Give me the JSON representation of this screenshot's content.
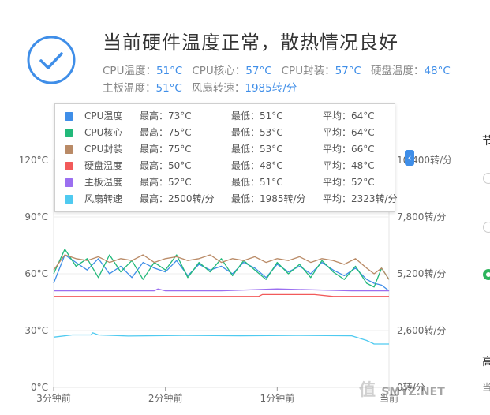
{
  "header": {
    "title": "当前硬件温度正常，散热情况良好",
    "metrics_row1": [
      {
        "label": "CPU温度：",
        "value": "51°C"
      },
      {
        "label": "CPU核心：",
        "value": "57°C"
      },
      {
        "label": "CPU封装：",
        "value": "57°C"
      },
      {
        "label": "硬盘温度：",
        "value": "48°C"
      }
    ],
    "metrics_row2": [
      {
        "label": "主板温度：",
        "value": "51°C"
      },
      {
        "label": "风扇转速：",
        "value": "1985转/分"
      }
    ]
  },
  "tooltip": {
    "rows": [
      {
        "name": "CPU温度",
        "color": "#3f8ee8",
        "max": "最高：73°C",
        "min": "最低：51°C",
        "avg": "平均：64°C"
      },
      {
        "name": "CPU核心",
        "color": "#22b97a",
        "max": "最高：75°C",
        "min": "最低：53°C",
        "avg": "平均：64°C"
      },
      {
        "name": "CPU封装",
        "color": "#b98a66",
        "max": "最高：75°C",
        "min": "最低：53°C",
        "avg": "平均：66°C"
      },
      {
        "name": "硬盘温度",
        "color": "#f25a5a",
        "max": "最高：50°C",
        "min": "最低：48°C",
        "avg": "平均：48°C"
      },
      {
        "name": "主板温度",
        "color": "#9b6ff0",
        "max": "最高：52°C",
        "min": "最低：51°C",
        "avg": "平均：52°C"
      },
      {
        "name": "风扇转速",
        "color": "#4fcaf0",
        "max": "最高：2500转/分",
        "min": "最低：1985转/分",
        "avg": "平均：2323转/分"
      }
    ]
  },
  "chart_data": {
    "type": "line",
    "x_tick_labels": [
      "3分钟前",
      "2分钟前",
      "1分钟前",
      "当前"
    ],
    "y_left": {
      "ticks": [
        "0°C",
        "30°C",
        "60°C",
        "90°C",
        "120°C"
      ],
      "ylim": [
        0,
        120
      ]
    },
    "y_right": {
      "ticks": [
        "0转/分",
        "2,600转/分",
        "5,200转/分",
        "7,800转/分",
        "10,400转/分"
      ],
      "ylim": [
        0,
        10400
      ]
    },
    "x_range": [
      0,
      180
    ],
    "series": [
      {
        "name": "CPU温度",
        "color": "#3f8ee8",
        "axis": "left",
        "x": [
          0,
          6,
          12,
          18,
          24,
          30,
          36,
          42,
          48,
          54,
          60,
          66,
          72,
          78,
          84,
          90,
          96,
          102,
          108,
          114,
          120,
          126,
          132,
          138,
          144,
          150,
          156,
          162,
          168,
          172,
          176,
          180
        ],
        "values": [
          55,
          70,
          66,
          62,
          68,
          60,
          64,
          58,
          66,
          63,
          61,
          67,
          59,
          65,
          62,
          64,
          60,
          66,
          63,
          58,
          65,
          61,
          64,
          60,
          66,
          62,
          59,
          63,
          57,
          55,
          54,
          51
        ]
      },
      {
        "name": "CPU核心",
        "color": "#22b97a",
        "axis": "left",
        "x": [
          0,
          6,
          12,
          18,
          24,
          30,
          36,
          42,
          48,
          54,
          60,
          66,
          72,
          78,
          84,
          90,
          96,
          102,
          108,
          114,
          120,
          126,
          132,
          138,
          144,
          150,
          156,
          162,
          168,
          172,
          176,
          180
        ],
        "values": [
          60,
          73,
          64,
          68,
          58,
          70,
          61,
          67,
          57,
          66,
          62,
          70,
          58,
          66,
          61,
          68,
          59,
          67,
          62,
          57,
          66,
          60,
          65,
          58,
          67,
          61,
          57,
          64,
          55,
          53,
          63,
          57
        ]
      },
      {
        "name": "CPU封装",
        "color": "#b98a66",
        "axis": "left",
        "x": [
          0,
          6,
          12,
          18,
          24,
          30,
          36,
          42,
          48,
          54,
          60,
          66,
          72,
          78,
          84,
          90,
          96,
          102,
          108,
          114,
          120,
          126,
          132,
          138,
          144,
          150,
          156,
          162,
          168,
          172,
          176,
          180
        ],
        "values": [
          62,
          70,
          68,
          67,
          69,
          66,
          68,
          67,
          70,
          66,
          68,
          69,
          67,
          68,
          70,
          66,
          68,
          67,
          69,
          66,
          68,
          67,
          69,
          66,
          68,
          67,
          65,
          68,
          63,
          60,
          63,
          57
        ]
      },
      {
        "name": "硬盘温度",
        "color": "#f25a5a",
        "axis": "left",
        "x": [
          0,
          40,
          80,
          110,
          112,
          140,
          150,
          160,
          180
        ],
        "values": [
          48,
          48,
          48,
          48,
          49,
          49,
          48,
          48,
          48
        ]
      },
      {
        "name": "主板温度",
        "color": "#9b6ff0",
        "axis": "left",
        "x": [
          0,
          40,
          54,
          56,
          60,
          90,
          120,
          160,
          180
        ],
        "values": [
          51,
          51,
          51,
          52,
          51,
          51,
          52,
          51,
          51
        ]
      },
      {
        "name": "风扇转速",
        "color": "#4fcaf0",
        "axis": "right",
        "x": [
          0,
          10,
          20,
          21,
          24,
          40,
          70,
          100,
          130,
          160,
          168,
          172,
          180
        ],
        "values": [
          2300,
          2400,
          2400,
          2500,
          2400,
          2350,
          2380,
          2360,
          2380,
          2360,
          2150,
          1985,
          1985
        ]
      }
    ]
  },
  "side_edge": {
    "glyph_top": "节",
    "glyph_bottom": "高",
    "glyph_bottom2": "当"
  },
  "watermark": {
    "mark": "值",
    "text": "SMYZ.NET"
  },
  "collapse_glyph": "‹"
}
